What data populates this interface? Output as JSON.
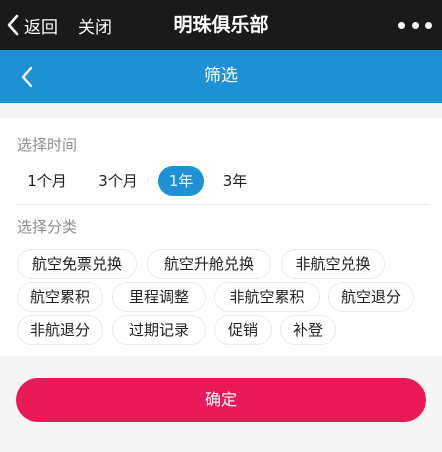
{
  "top_bar": {
    "back_label": "返回",
    "close_label": "关闭",
    "title": "明珠俱乐部",
    "more_icon": "more-dots-icon"
  },
  "nav": {
    "title": "筛选",
    "back_icon": "chevron-left-icon"
  },
  "filter": {
    "time_label": "选择时间",
    "time_options": [
      "1个月",
      "3个月",
      "1年",
      "3年"
    ],
    "time_selected": "1年",
    "category_label": "选择分类",
    "categories": [
      "航空免票兑换",
      "航空升舱兑换",
      "非航空兑换",
      "航空累积",
      "里程调整",
      "非航空累积",
      "航空退分",
      "非航退分",
      "过期记录",
      "促销",
      "补登"
    ]
  },
  "confirm_label": "确定",
  "colors": {
    "top_bar_bg": "#1a1a1a",
    "nav_bg": "#1e91d6",
    "active_chip": "#1e91d6",
    "confirm_bg": "#ea1a59",
    "page_bg": "#f4f4f4"
  }
}
